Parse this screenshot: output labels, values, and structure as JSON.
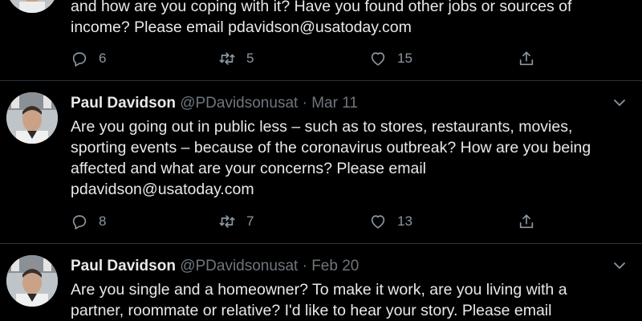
{
  "tweets": [
    {
      "text": "and how are you coping with it? Have you found other jobs or sources of\nincome? Please email pdavidson@usatoday.com",
      "replies": "6",
      "retweets": "5",
      "likes": "15"
    },
    {
      "name": "Paul Davidson",
      "handle": "@PDavidsonusat",
      "sep": "·",
      "date": "Mar 11",
      "text": "Are you going out in public less – such as to stores, restaurants, movies,\nsporting events – because of the coronavirus outbreak? How are you being\naffected and what are your concerns? Please email\npdavidson@usatoday.com",
      "replies": "8",
      "retweets": "7",
      "likes": "13"
    },
    {
      "name": "Paul Davidson",
      "handle": "@PDavidsonusat",
      "sep": "·",
      "date": "Feb 20",
      "text": "Are you single and a homeowner? To make it work, are you living with a\npartner, roommate or relative? I'd like to hear your story. Please email"
    }
  ],
  "icons": {
    "reply": "reply-icon",
    "retweet": "retweet-icon",
    "like": "like-icon",
    "share": "share-icon",
    "more": "chevron-down-icon"
  },
  "colors": {
    "background": "#000000",
    "text": "#e7e9ea",
    "muted": "#6e767d",
    "divider": "#2f3336"
  }
}
